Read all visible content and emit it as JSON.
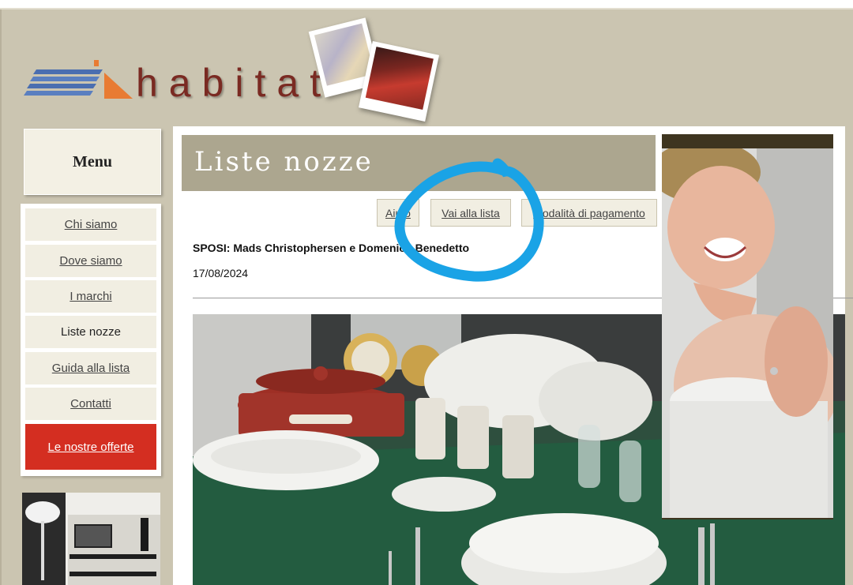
{
  "brand": {
    "logo_text": "habitat"
  },
  "menu": {
    "heading": "Menu",
    "items": [
      {
        "label": "Chi siamo"
      },
      {
        "label": "Dove siamo"
      },
      {
        "label": "I marchi"
      },
      {
        "label": "Liste nozze"
      },
      {
        "label": "Guida alla lista"
      },
      {
        "label": "Contatti"
      }
    ],
    "offer_label": "Le nostre offerte"
  },
  "page": {
    "title": "Liste nozze",
    "tabs": [
      {
        "label": "Aiuto"
      },
      {
        "label": "Vai alla lista"
      },
      {
        "label": "Modalità di pagamento"
      }
    ],
    "couple": "SPOSI: Mads Christophersen e Domenico Benedetto",
    "date": "17/08/2024"
  },
  "colors": {
    "background": "#cbc5b1",
    "title_bar": "#aca68f",
    "offer_button": "#d42e21",
    "annotation_circle": "#1aa3e6"
  }
}
